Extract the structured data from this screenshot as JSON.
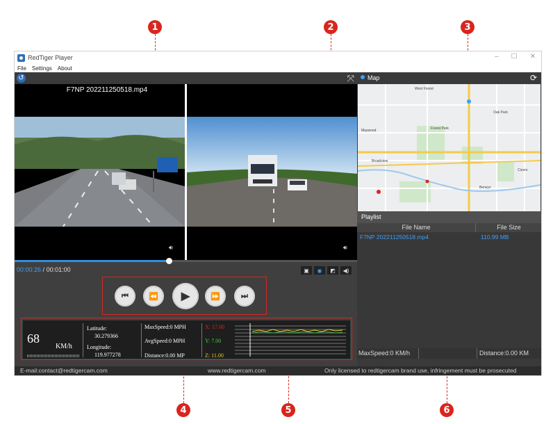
{
  "callouts": [
    "1",
    "2",
    "3",
    "4",
    "5",
    "6"
  ],
  "window": {
    "title": "RedTiger Player",
    "controls": [
      "–",
      "☐",
      "✕"
    ],
    "menu": [
      "File",
      "Settings",
      "About"
    ]
  },
  "video": {
    "file_name": "F7NP 202211250518.mp4",
    "current_time": "00:00:26",
    "time_separator": " / ",
    "total_time": "00:01:00",
    "progress": 0.45
  },
  "telemetry": {
    "speed": "68",
    "speed_unit": "KM/h",
    "latitude_label": "Latitude:",
    "latitude": "30.279366",
    "longitude_label": "Longitude:",
    "longitude": "119.977278",
    "max_speed": "MaxSpeed:0 MPH",
    "avg_speed": "AvgSpeed:0 MPH",
    "distance": "Distance:0.00 MP",
    "x": "X: 17.00",
    "y": "Y: 7.00",
    "z": "Z: 11.00"
  },
  "map": {
    "title": "Map",
    "labels": [
      "West Forest",
      "Forest Park",
      "Oak Park",
      "Maywood",
      "Broadview",
      "Cicero",
      "Berwyn"
    ]
  },
  "playlist": {
    "title": "Playlist",
    "col_name": "File Name",
    "col_size": "File Size",
    "rows": [
      {
        "name": "F7NP 202211250518.mp4",
        "size": "110.99 MB"
      }
    ]
  },
  "stats": {
    "max_speed": "MaxSpeed:0 KM/h",
    "distance": "Distance:0.00 KM"
  },
  "footer": {
    "email": "E-mail:contact@redtigercam.com",
    "website": "www.redtigercam.com",
    "notice": "Only licensed to redtigercam brand use, infringement must be prosecuted"
  },
  "colors": {
    "accent": "#3ba0ff",
    "callout": "#d9251d"
  }
}
